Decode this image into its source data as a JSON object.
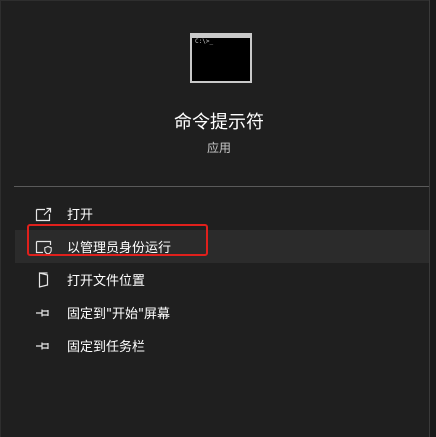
{
  "app": {
    "title": "命令提示符",
    "subtitle": "应用",
    "icon": "command-prompt-icon",
    "icon_prompt_text": "C:\\>_"
  },
  "menu": {
    "items": [
      {
        "label": "打开",
        "icon": "open-icon"
      },
      {
        "label": "以管理员身份运行",
        "icon": "run-as-admin-icon"
      },
      {
        "label": "打开文件位置",
        "icon": "file-location-icon"
      },
      {
        "label": "固定到\"开始\"屏幕",
        "icon": "pin-icon"
      },
      {
        "label": "固定到任务栏",
        "icon": "pin-icon"
      }
    ]
  },
  "colors": {
    "background": "#1f1f1f",
    "highlight": "#2b2b2b",
    "annotation_box": "#e0201c"
  }
}
